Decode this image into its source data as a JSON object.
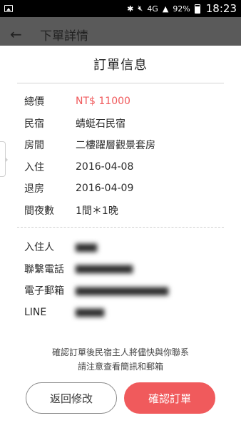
{
  "status_bar": {
    "network": "4G",
    "battery": "92%",
    "time": "18:23"
  },
  "app_bar": {
    "title": "下單詳情"
  },
  "dialog": {
    "title": "訂單信息",
    "order_rows": [
      {
        "label": "總價",
        "value": "NT$ 11000"
      },
      {
        "label": "民宿",
        "value": "蜻蜓石民宿"
      },
      {
        "label": "房間",
        "value": "二樓躍層觀景套房"
      },
      {
        "label": "入住",
        "value": "2016-04-08"
      },
      {
        "label": "退房",
        "value": "2016-04-09"
      },
      {
        "label": "間夜數",
        "value": "1間＊1晚"
      }
    ],
    "guest_rows": [
      {
        "label": "入住人"
      },
      {
        "label": "聯繫電話"
      },
      {
        "label": "電子郵箱"
      },
      {
        "label": "LINE"
      }
    ],
    "notice_line1": "確認訂單後民宿主人將儘快與你聯系",
    "notice_line2": "請注意查看簡訊和郵箱",
    "back_button": "返回修改",
    "confirm_button": "確認訂單"
  },
  "colors": {
    "accent": "#f05a5c",
    "overlay": "#5a5a5a"
  }
}
